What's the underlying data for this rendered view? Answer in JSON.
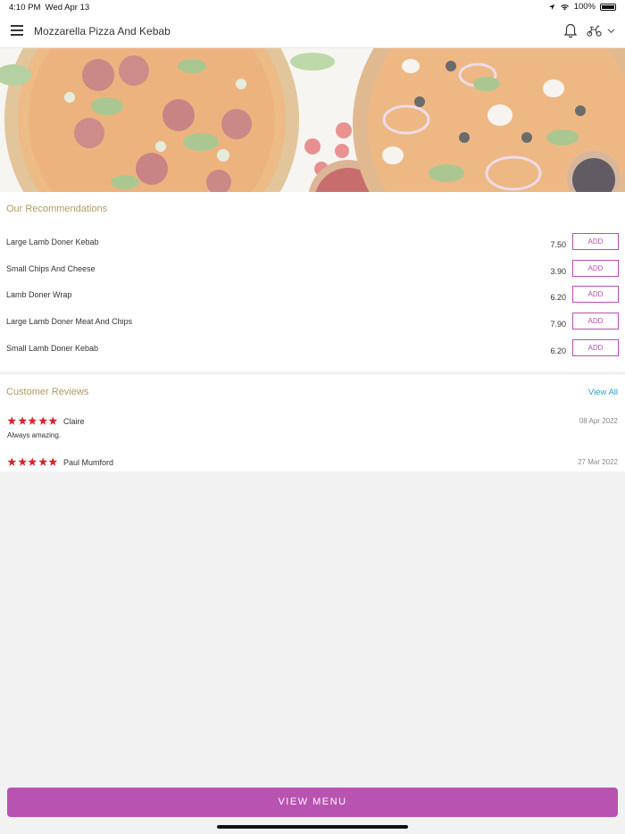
{
  "status_bar": {
    "time": "4:10 PM",
    "date": "Wed Apr 13",
    "battery": "100%"
  },
  "header": {
    "title": "Mozzarella Pizza And Kebab"
  },
  "recommendations": {
    "title": "Our Recommendations",
    "add_label": "ADD",
    "items": [
      {
        "name": "Large Lamb Doner Kebab",
        "price": "7.50"
      },
      {
        "name": "Small Chips And Cheese",
        "price": "3.90"
      },
      {
        "name": "Lamb Doner Wrap",
        "price": "6.20"
      },
      {
        "name": "Large Lamb Doner Meat And Chips",
        "price": "7.90"
      },
      {
        "name": "Small Lamb Doner Kebab",
        "price": "6.20"
      }
    ]
  },
  "reviews": {
    "title": "Customer Reviews",
    "view_all": "View All",
    "items": [
      {
        "name": "Claire",
        "date": "08 Apr 2022",
        "text": "Always amazing.",
        "rating": 5
      },
      {
        "name": "Paul Mumford",
        "date": "27 Mar 2022",
        "text": "",
        "rating": 5
      }
    ]
  },
  "footer": {
    "button": "VIEW MENU"
  },
  "colors": {
    "accent": "#b953b1",
    "link": "#2aa0c8",
    "section_title": "#b09a5e",
    "star": "#d8252f"
  }
}
